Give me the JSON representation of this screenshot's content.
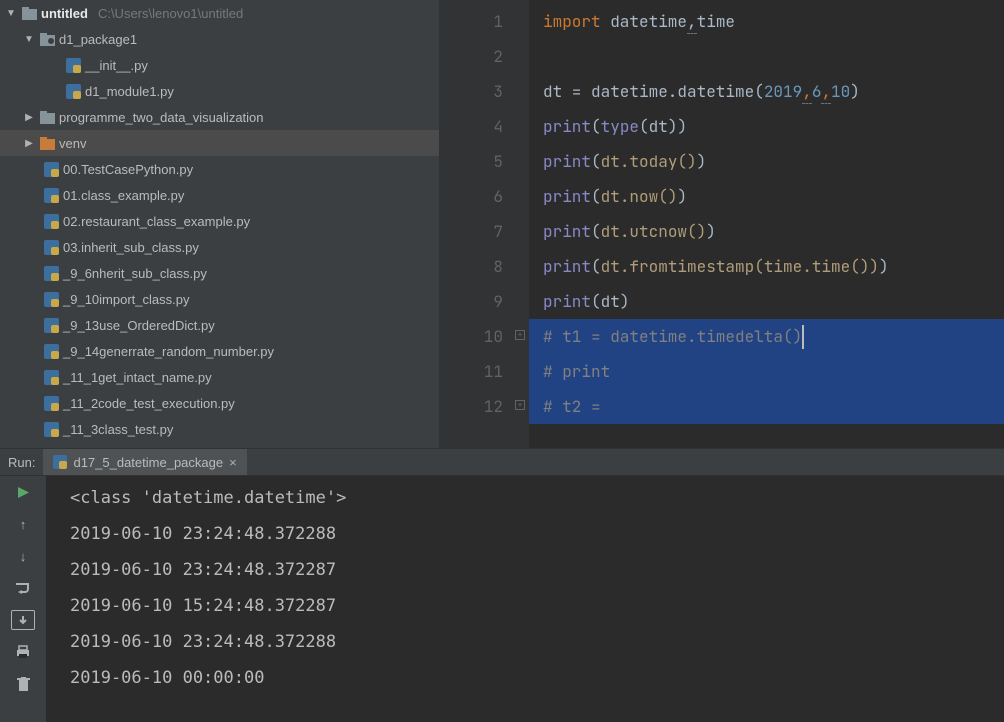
{
  "project": {
    "name": "untitled",
    "path": "C:\\Users\\lenovo1\\untitled"
  },
  "tree": {
    "d1_package1": "d1_package1",
    "init_py": "__init__.py",
    "d1_module1": "d1_module1.py",
    "prog_two": "programme_two_data_visualization",
    "venv": "venv",
    "f00": "00.TestCasePython.py",
    "f01": "01.class_example.py",
    "f02": "02.restaurant_class_example.py",
    "f03": "03.inherit_sub_class.py",
    "f9_6": "_9_6nherit_sub_class.py",
    "f9_10": "_9_10import_class.py",
    "f9_13": "_9_13use_OrderedDict.py",
    "f9_14": "_9_14generrate_random_number.py",
    "f11_1": "_11_1get_intact_name.py",
    "f11_2": "_11_2code_test_execution.py",
    "f11_3": "_11_3class_test.py"
  },
  "editor": {
    "lines": [
      "1",
      "2",
      "3",
      "4",
      "5",
      "6",
      "7",
      "8",
      "9",
      "10",
      "11",
      "12"
    ]
  },
  "code": {
    "l1_import": "import",
    "l1_mods": " datetime",
    "l1_comma_time": "time",
    "l3_dt": "dt = datetime.datetime(",
    "l3_y": "2019",
    "l3_m": "6",
    "l3_d": "10",
    "l4": "print",
    "l4_in": "type",
    "l4_arg": "dt",
    "l5": "print",
    "l5_call": "dt.today()",
    "l6": "print",
    "l6_call": "dt.now()",
    "l7": "print",
    "l7_call": "dt.utcnow()",
    "l8": "print",
    "l8_call": "dt.fromtimestamp(time.time())",
    "l9": "print",
    "l9_arg": "dt",
    "l10": "# t1 = datetime.timedelta()",
    "l11": "# print",
    "l12": "# t2 ="
  },
  "run": {
    "label": "Run:",
    "tab": "d17_5_datetime_package"
  },
  "console": {
    "lines": [
      "<class 'datetime.datetime'>",
      "2019-06-10 23:24:48.372288",
      "2019-06-10 23:24:48.372287",
      "2019-06-10 15:24:48.372287",
      "2019-06-10 23:24:48.372288",
      "2019-06-10 00:00:00"
    ]
  }
}
